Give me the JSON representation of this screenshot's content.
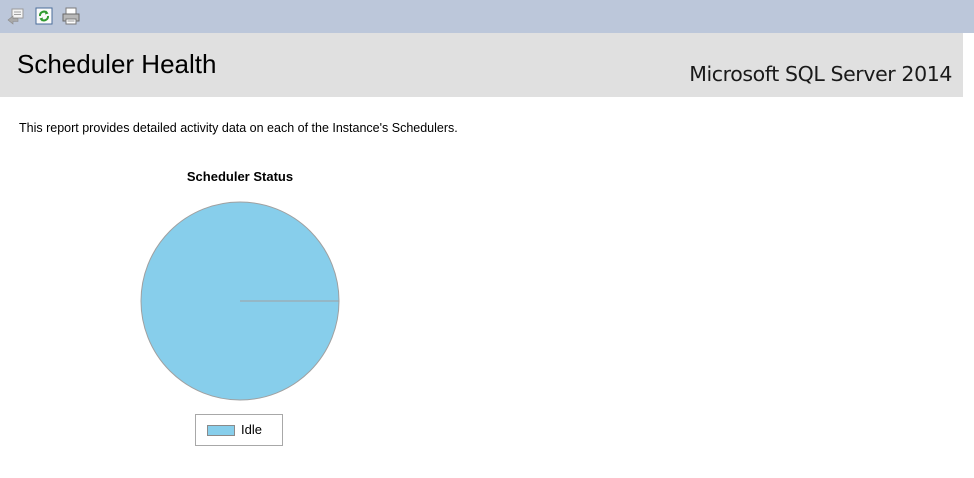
{
  "toolbar": {
    "buttons": [
      {
        "name": "back-icon"
      },
      {
        "name": "refresh-icon"
      },
      {
        "name": "print-icon"
      }
    ]
  },
  "header": {
    "title": "Scheduler Health",
    "product": "Microsoft SQL Server 2014"
  },
  "report": {
    "description": "This report provides detailed activity data on each of the Instance's Schedulers."
  },
  "colors": {
    "toolbar_bg": "#bcc7da",
    "header_bg": "#e0e0e0",
    "idle": "#87ceeb"
  },
  "chart_data": {
    "type": "pie",
    "title": "Scheduler Status",
    "categories": [
      "Idle"
    ],
    "values": [
      100
    ],
    "colors": [
      "#87ceeb"
    ],
    "legend": "bottom"
  }
}
